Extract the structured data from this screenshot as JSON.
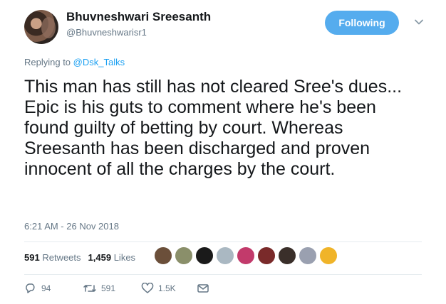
{
  "author": {
    "name": "Bhuvneshwari Sreesanth",
    "handle": "@Bhuvneshwarisr1"
  },
  "follow_button": {
    "label": "Following",
    "color": "#55acee"
  },
  "reply": {
    "prefix": "Replying to ",
    "mention": "@Dsk_Talks"
  },
  "tweet": {
    "text": "This man has still has not cleared Sree's dues... Epic is his guts to comment where he's been found guilty of betting by court. Whereas Sreesanth has been discharged and proven innocent of all the charges by the court."
  },
  "timestamp": "6:21 AM - 26 Nov 2018",
  "stats": {
    "retweets_count": "591",
    "retweets_label": "Retweets",
    "likes_count": "1,459",
    "likes_label": "Likes"
  },
  "liker_avatars": [
    "#6b4f3a",
    "#8a8f6a",
    "#1a1a1a",
    "#aab8c2",
    "#c23a6b",
    "#7a2a2a",
    "#3a2f2a",
    "#9aa0b0",
    "#f0b429"
  ],
  "actions": {
    "reply_count": "94",
    "retweet_count": "591",
    "like_count": "1.5K"
  },
  "colors": {
    "text": "#14171a",
    "muted": "#657786",
    "link": "#1da1f2",
    "divider": "#e6ecf0"
  }
}
